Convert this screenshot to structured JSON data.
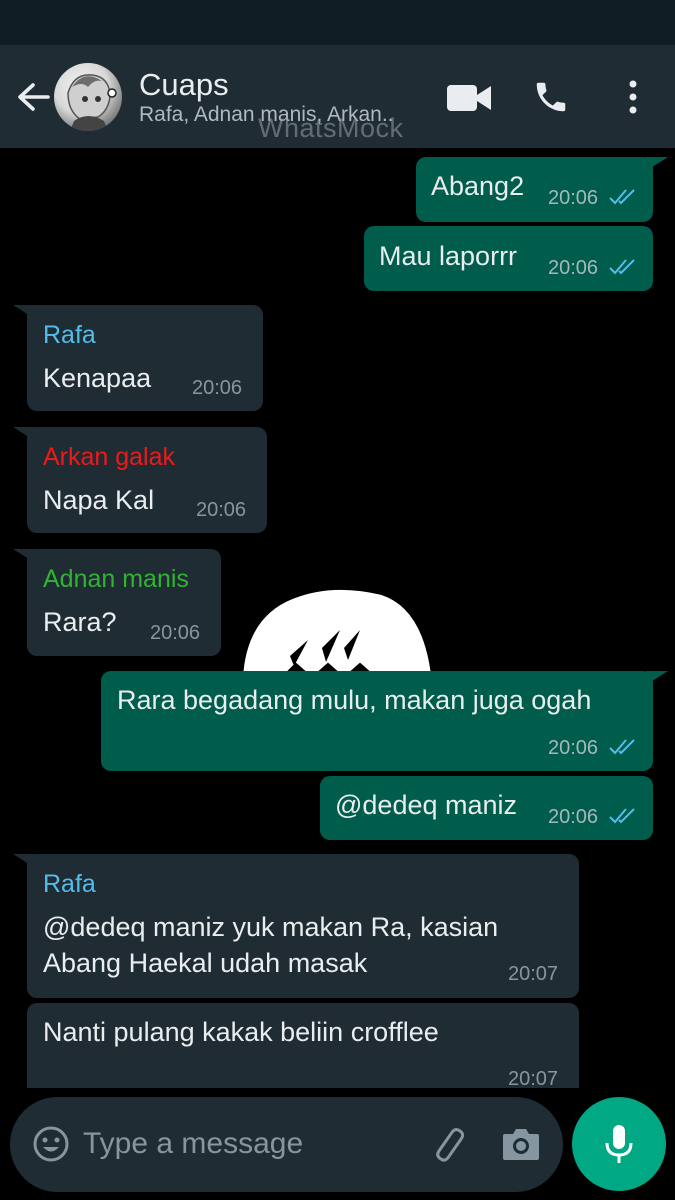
{
  "header": {
    "title": "Cuaps",
    "subtitle": "Rafa, Adnan manis, Arkan..",
    "watermark": "WhatsMock"
  },
  "messages": [
    {
      "dir": "out",
      "text": "Abang2",
      "time": "20:06",
      "status": "read"
    },
    {
      "dir": "out",
      "text": "Mau laporrr",
      "time": "20:06",
      "status": "read"
    },
    {
      "dir": "in",
      "sender": "Rafa",
      "sender_color": "#53bdeb",
      "text": "Kenapaa",
      "time": "20:06"
    },
    {
      "dir": "in",
      "sender": "Arkan galak",
      "sender_color": "#f01919",
      "text": "Napa Kal",
      "time": "20:06"
    },
    {
      "dir": "in",
      "sender": "Adnan manis",
      "sender_color": "#2fb52f",
      "text": "Rara?",
      "time": "20:06"
    },
    {
      "dir": "out",
      "text": "Rara begadang mulu, makan juga ogah",
      "time": "20:06",
      "status": "read"
    },
    {
      "dir": "out",
      "text": "@dedeq maniz",
      "time": "20:06",
      "status": "read"
    },
    {
      "dir": "in",
      "sender": "Rafa",
      "sender_color": "#53bdeb",
      "text_lines": [
        "@dedeq maniz yuk makan Ra, kasian",
        "Abang Haekal udah masak"
      ],
      "time": "20:07"
    },
    {
      "dir": "in",
      "text": "Nanti pulang kakak beliin crofflee",
      "time": "20:07"
    }
  ],
  "composer": {
    "placeholder": "Type a message"
  },
  "colors": {
    "outgoing_bubble": "#005c4b",
    "incoming_bubble": "#1f2c34",
    "header": "#1f2c34",
    "accent": "#00a884",
    "read_ticks": "#53bdeb"
  },
  "icons": [
    "back-arrow-icon",
    "video-call-icon",
    "voice-call-icon",
    "more-options-icon",
    "emoji-icon",
    "attach-icon",
    "camera-icon",
    "mic-icon"
  ]
}
